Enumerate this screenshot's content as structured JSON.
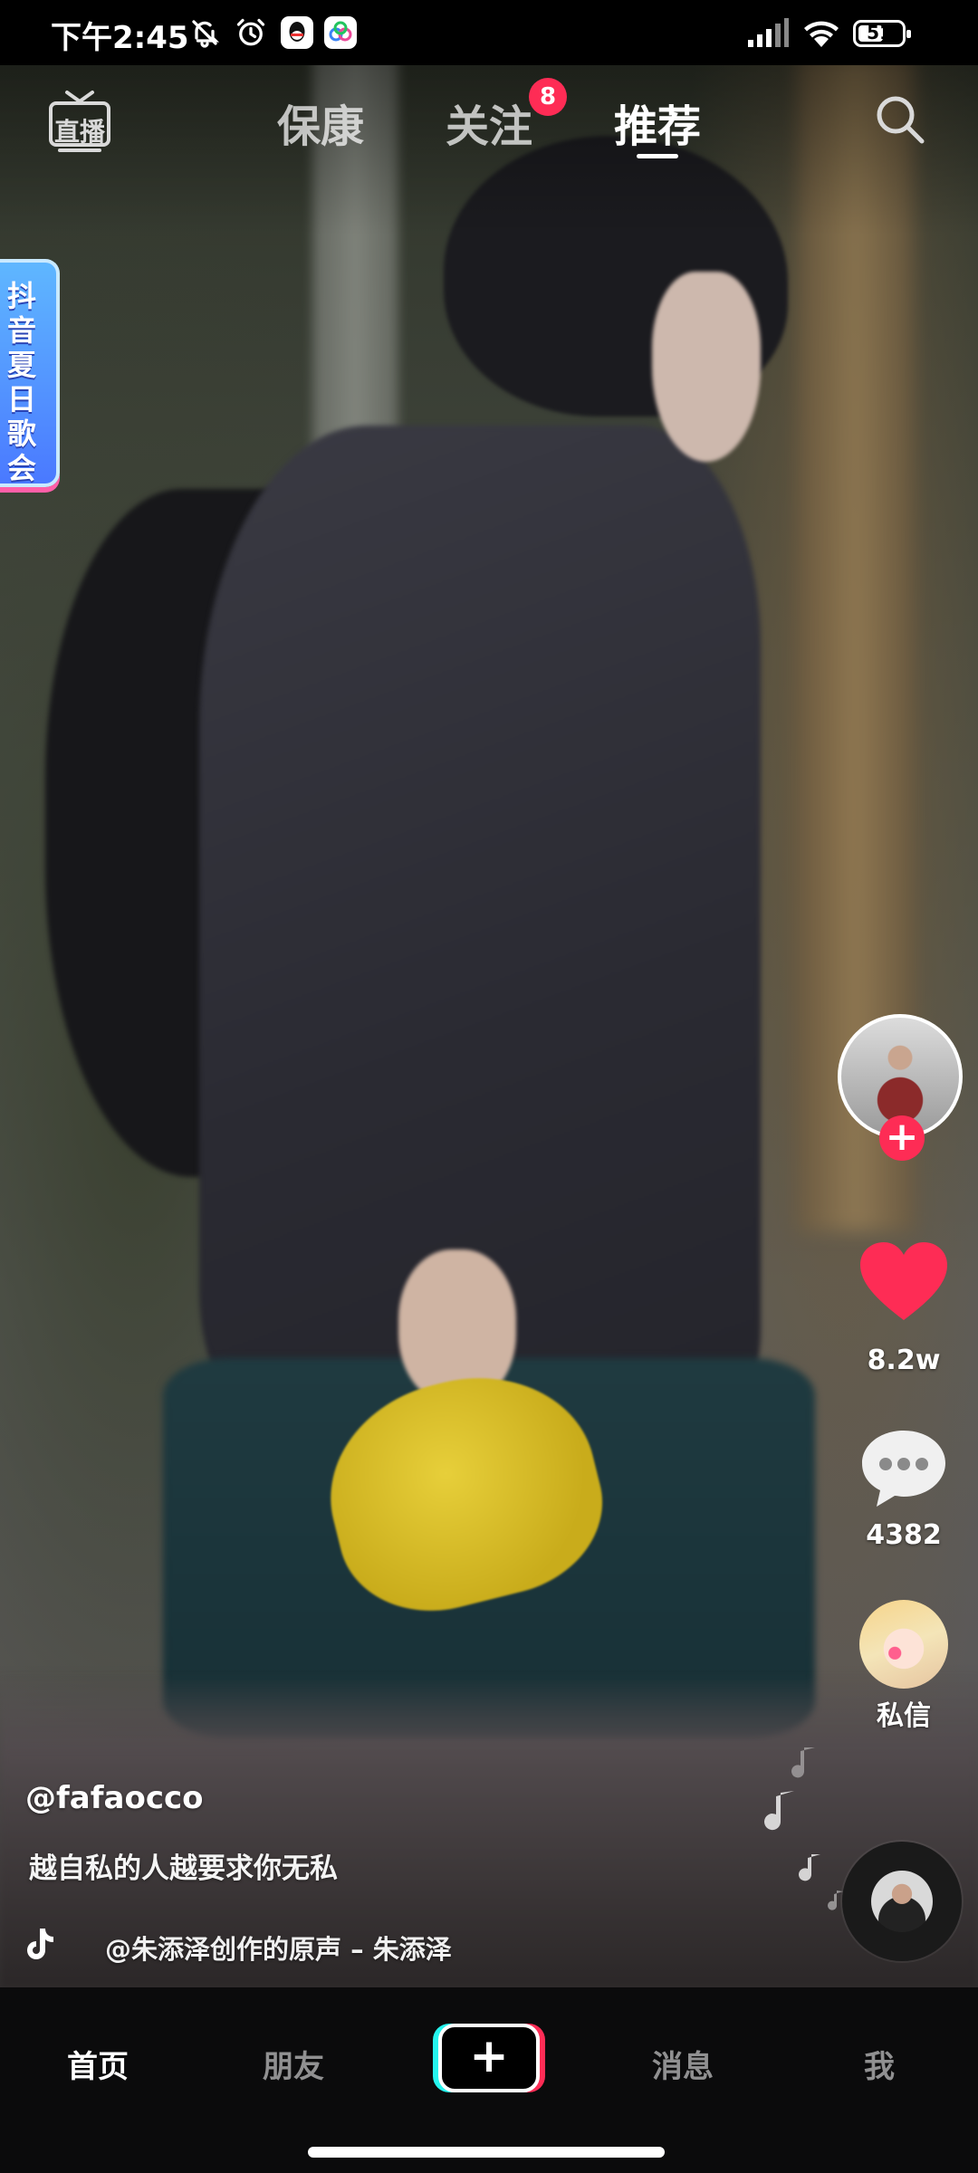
{
  "status_bar": {
    "time": "下午2:45",
    "icons": [
      "mute-bell-icon",
      "alarm-icon",
      "qq-app-icon",
      "cloud-app-icon",
      "signal-icon",
      "wifi-icon"
    ],
    "battery": "51"
  },
  "top_nav": {
    "live_label": "直播",
    "tabs": [
      {
        "label": "保康"
      },
      {
        "label": "关注",
        "badge": "8"
      },
      {
        "label": "推荐",
        "active": true
      }
    ]
  },
  "event_banner": {
    "text": "抖音夏日歌会"
  },
  "side_actions": {
    "likes": "8.2w",
    "comments": "4382",
    "dm_label": "私信"
  },
  "video": {
    "username": "@fafaocco",
    "caption": "越自私的人越要求你无私",
    "music": "@朱添泽创作的原声 – 朱添泽"
  },
  "bottom_nav": {
    "items": [
      {
        "label": "首页",
        "active": true
      },
      {
        "label": "朋友"
      },
      {
        "label": "+"
      },
      {
        "label": "消息"
      },
      {
        "label": "我"
      }
    ]
  },
  "colors": {
    "accent_red": "#fe2c55",
    "accent_cyan": "#25f4ee",
    "background": "#0b0b0c",
    "text": "#ffffff"
  }
}
